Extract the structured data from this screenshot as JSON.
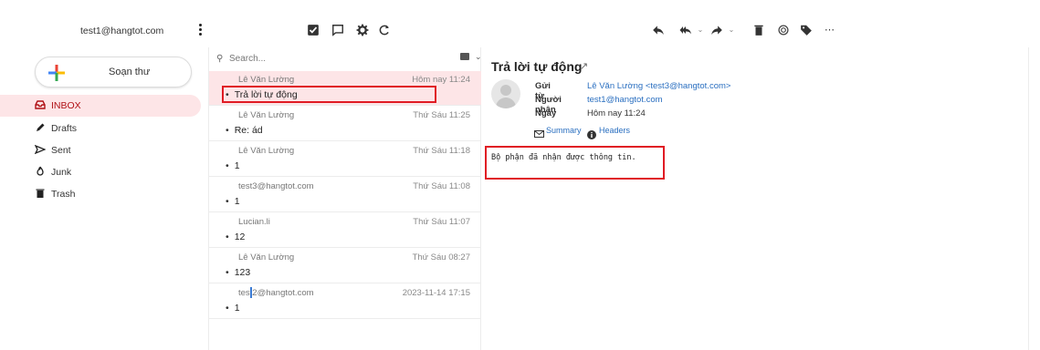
{
  "account": {
    "email": "test1@hangtot.com"
  },
  "compose": {
    "label": "Soạn thư"
  },
  "folders": [
    {
      "label": "INBOX",
      "icon": "inbox-icon",
      "active": true
    },
    {
      "label": "Drafts",
      "icon": "pencil-icon"
    },
    {
      "label": "Sent",
      "icon": "send-icon"
    },
    {
      "label": "Junk",
      "icon": "fire-icon"
    },
    {
      "label": "Trash",
      "icon": "trash-icon"
    }
  ],
  "toolbar": {
    "mid": [
      "select-icon",
      "threads-icon",
      "settings-icon",
      "refresh-icon"
    ],
    "right": [
      "reply-icon",
      "reply-all-icon",
      "forward-icon",
      "delete-icon",
      "mark-icon",
      "tag-icon",
      "more-icon"
    ]
  },
  "search": {
    "placeholder": "Search..."
  },
  "messages": [
    {
      "from": "Lê Văn Lường",
      "date": "Hôm nay 11:24",
      "subject": "Trả lời tự động",
      "selected": true
    },
    {
      "from": "Lê Văn Lường",
      "date": "Thứ Sáu 11:25",
      "subject": "Re: ád"
    },
    {
      "from": "Lê Văn Lường",
      "date": "Thứ Sáu 11:18",
      "subject": "1"
    },
    {
      "from": "test3@hangtot.com",
      "date": "Thứ Sáu 11:08",
      "subject": "1"
    },
    {
      "from": "Lucian.li",
      "date": "Thứ Sáu 11:07",
      "subject": "12"
    },
    {
      "from": "Lê Văn Lường",
      "date": "Thứ Sáu 08:27",
      "subject": "123"
    },
    {
      "from": "test2@hangtot.com",
      "date": "2023-11-14 17:15",
      "subject": "1"
    }
  ],
  "preview": {
    "title": "Trả lời tự động",
    "from_label": "Gửi từ",
    "from_value": "Lê Văn Lường <test3@hangtot.com>",
    "to_label": "Người nhận",
    "to_value": "test1@hangtot.com",
    "date_label": "Ngày",
    "date_value": "Hôm nay 11:24",
    "tab_summary": "Summary",
    "tab_headers": "Headers",
    "body": "Bộ phận đã nhận được thông tin."
  },
  "colors": {
    "accent": "#b01015",
    "highlight_border": "#e01b24",
    "link": "#2a6fc0",
    "selected_bg": "#fde5e7"
  }
}
